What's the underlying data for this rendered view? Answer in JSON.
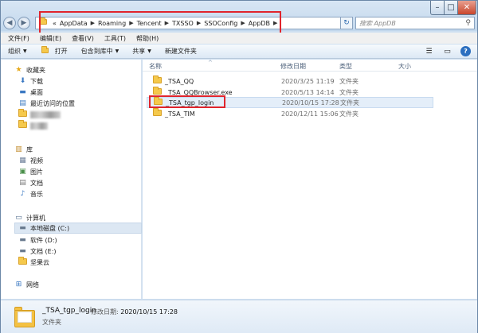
{
  "address": {
    "prefix": "«",
    "crumbs": [
      "AppData",
      "Roaming",
      "Tencent",
      "TXSSO",
      "SSOConfig",
      "AppDB"
    ]
  },
  "search": {
    "placeholder": "搜索 AppDB"
  },
  "menu": [
    "文件(F)",
    "编辑(E)",
    "查看(V)",
    "工具(T)",
    "帮助(H)"
  ],
  "toolbar": {
    "organize": "组织",
    "open": "打开",
    "include": "包含到库中",
    "share": "共享",
    "new_folder": "新建文件夹"
  },
  "nav": {
    "favorites": "收藏夹",
    "downloads": "下载",
    "desktop": "桌面",
    "recent": "最近访问的位置",
    "libraries": "库",
    "videos": "视频",
    "pictures": "图片",
    "documents": "文档",
    "music": "音乐",
    "computer": "计算机",
    "drive_c": "本地磁盘 (C:)",
    "drive_d": "软件 (D:)",
    "drive_e": "文档 (E:)",
    "nutstore": "坚果云",
    "network": "网络"
  },
  "columns": {
    "name": "名称",
    "date": "修改日期",
    "type": "类型",
    "size": "大小"
  },
  "files": [
    {
      "name": "_TSA_QQ",
      "date": "2020/3/25 11:19",
      "type": "文件夹"
    },
    {
      "name": "_TSA_QQBrowser.exe",
      "date": "2020/5/13 14:14",
      "type": "文件夹"
    },
    {
      "name": "_TSA_tgp_login",
      "date": "2020/10/15 17:28",
      "type": "文件夹"
    },
    {
      "name": "_TSA_TIM",
      "date": "2020/12/11 15:06",
      "type": "文件夹"
    }
  ],
  "details": {
    "name": "_TSA_tgp_login",
    "modified_label": "修改日期:",
    "modified_value": "2020/10/15 17:28",
    "type": "文件夹"
  },
  "colors": {
    "highlight": "#e0242c",
    "folder": "#f5c94c",
    "selection": "#e4eef9"
  }
}
